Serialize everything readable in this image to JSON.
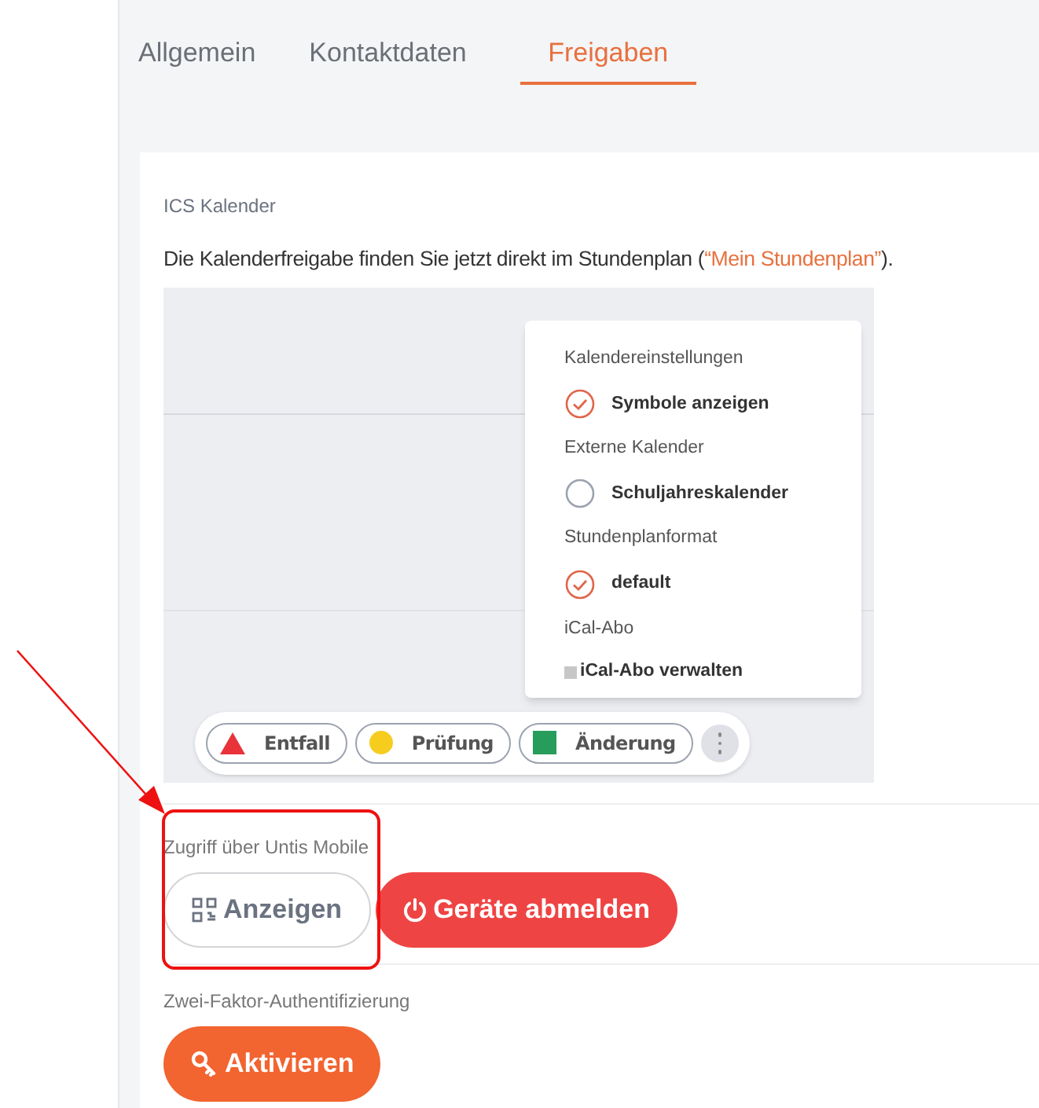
{
  "tabs": [
    {
      "label": "Allgemein",
      "selected": false
    },
    {
      "label": "Kontaktdaten",
      "selected": false
    },
    {
      "label": "Freigaben",
      "selected": true
    }
  ],
  "ics": {
    "heading": "ICS Kalender",
    "text": "Die Kalenderfreigabe finden Sie jetzt direkt im Stundenplan (",
    "link": "“Mein Stundenplan”",
    "text_end": ")."
  },
  "preview": {
    "menu": [
      {
        "kind": "heading",
        "label": "Kalendereinstellungen"
      },
      {
        "kind": "option",
        "label": "Symbole anzeigen",
        "checked": true
      },
      {
        "kind": "heading",
        "label": "Externe Kalender"
      },
      {
        "kind": "option",
        "label": "Schuljahreskalender",
        "checked": false
      },
      {
        "kind": "heading",
        "label": "Stundenplanformat"
      },
      {
        "kind": "option",
        "label": "default",
        "checked": true
      },
      {
        "kind": "heading",
        "label": "iCal-Abo"
      },
      {
        "kind": "link",
        "label": "iCal-Abo verwalten"
      }
    ],
    "legend": [
      {
        "kind": "triangle",
        "label": "Entfall",
        "color": "#e8333a"
      },
      {
        "kind": "circle",
        "label": "Prüfung",
        "color": "#f6cd1e"
      },
      {
        "kind": "square",
        "label": "Änderung",
        "color": "#279d5b"
      }
    ]
  },
  "sections": [
    {
      "heading": "Zugriff über Untis Mobile",
      "buttons": [
        {
          "kind": "qr",
          "label": "Anzeigen"
        },
        {
          "kind": "power",
          "label": "Geräte abmelden"
        }
      ]
    },
    {
      "heading": "Zwei-Faktor-Authentifizierung",
      "buttons": [
        {
          "kind": "key",
          "label": "Aktivieren"
        }
      ]
    }
  ]
}
